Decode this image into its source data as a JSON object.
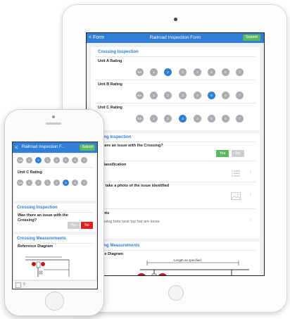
{
  "colors": {
    "brand_blue": "#2f7ed8",
    "submit_green": "#5cb85c",
    "no_red": "#e11f1f",
    "rating_gray": "#a9adb2"
  },
  "tablet": {
    "header": {
      "back_label": "< Form",
      "title": "Railroad Inspection Form",
      "submit_label": "Submit"
    },
    "crossing_inspection_title": "Crossing Inspection",
    "ratings": [
      {
        "label": "Unit A Rating",
        "selected": "2"
      },
      {
        "label": "Unit B Rating",
        "selected": "5"
      },
      {
        "label": "Unit C Rating",
        "selected": "3"
      }
    ],
    "rating_options": [
      "NA",
      "1",
      "2",
      "3",
      "4",
      "5",
      "6",
      "7"
    ],
    "section2_title": "ssing Inspection",
    "question": "s there an issue with the Crossing?",
    "yes_label": "Yes",
    "no_label": "No",
    "issue_classification": "e Classification",
    "photo_prompt": "ase take a photo of the issue identified",
    "comments_label": "ments",
    "comments_value": "crossing bots near top bar are loose",
    "measurements_title": "ssing Measurements",
    "reference_label": "ence Diagram",
    "diagram_caption": "Length as specified"
  },
  "phone": {
    "header": {
      "back_label": "<",
      "title": "Railroad Inspection F...",
      "submit_label": "Submit"
    },
    "top_row_options": [
      "NA",
      "1",
      "2",
      "3",
      "4",
      "5",
      "6",
      "7"
    ],
    "top_row_selected": "2",
    "unit_c_label": "Unit C Rating",
    "unit_c_selected": "5",
    "crossing_inspection_title": "Crossing Inspection",
    "question": "Was there an issue with the Crossing?",
    "yes_label": "Yes",
    "no_label": "No",
    "measurements_title": "Crossing Measurements",
    "reference_label": "Reference Diagram",
    "footer_count": "0"
  }
}
